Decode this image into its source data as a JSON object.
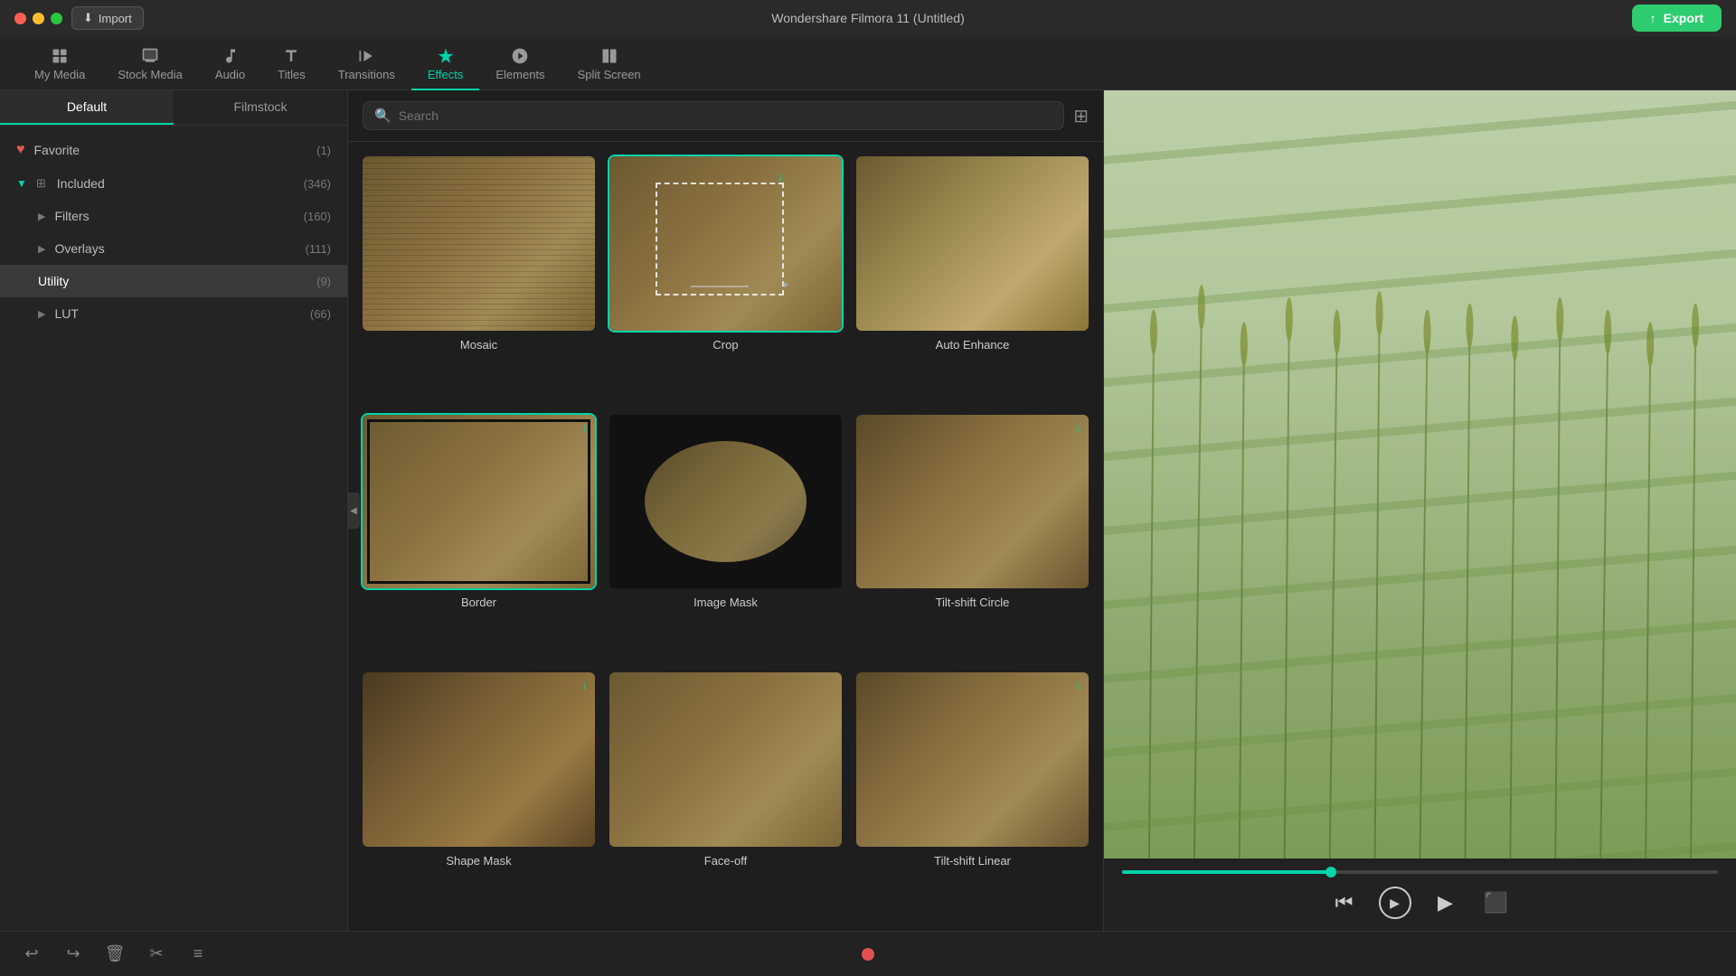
{
  "titlebar": {
    "title": "Wondershare Filmora 11 (Untitled)",
    "import_label": "Import",
    "export_label": "Export"
  },
  "nav": {
    "items": [
      {
        "id": "my-media",
        "label": "My Media",
        "icon": "grid"
      },
      {
        "id": "stock-media",
        "label": "Stock Media",
        "icon": "stock"
      },
      {
        "id": "audio",
        "label": "Audio",
        "icon": "music"
      },
      {
        "id": "titles",
        "label": "Titles",
        "icon": "text"
      },
      {
        "id": "transitions",
        "label": "Transitions",
        "icon": "transition"
      },
      {
        "id": "effects",
        "label": "Effects",
        "icon": "effects",
        "active": true
      },
      {
        "id": "elements",
        "label": "Elements",
        "icon": "elements"
      },
      {
        "id": "split-screen",
        "label": "Split Screen",
        "icon": "split"
      }
    ]
  },
  "sidebar": {
    "tabs": [
      {
        "id": "default",
        "label": "Default",
        "active": true
      },
      {
        "id": "filmstock",
        "label": "Filmstock"
      }
    ],
    "items": [
      {
        "id": "favorite",
        "label": "Favorite",
        "count": "(1)",
        "icon": "heart",
        "indent": 0
      },
      {
        "id": "included",
        "label": "Included",
        "count": "(346)",
        "icon": "grid",
        "indent": 0,
        "expanded": true
      },
      {
        "id": "filters",
        "label": "Filters",
        "count": "(160)",
        "indent": 1
      },
      {
        "id": "overlays",
        "label": "Overlays",
        "count": "(111)",
        "indent": 1
      },
      {
        "id": "utility",
        "label": "Utility",
        "count": "(9)",
        "indent": 1,
        "active": true
      },
      {
        "id": "lut",
        "label": "LUT",
        "count": "(66)",
        "indent": 1
      }
    ]
  },
  "search": {
    "placeholder": "Search"
  },
  "effects": [
    {
      "id": "mosaic",
      "label": "Mosaic",
      "type": "vineyard"
    },
    {
      "id": "crop",
      "label": "Crop",
      "type": "dashed",
      "selected": true
    },
    {
      "id": "auto-enhance",
      "label": "Auto Enhance",
      "type": "vineyard-tilt"
    },
    {
      "id": "border",
      "label": "Border",
      "type": "border",
      "selected": true
    },
    {
      "id": "image-mask",
      "label": "Image Mask",
      "type": "circle"
    },
    {
      "id": "tilt-shift-circle",
      "label": "Tilt-shift Circle",
      "type": "vineyard-blur"
    },
    {
      "id": "shape-mask",
      "label": "Shape Mask",
      "type": "vineyard-dark"
    },
    {
      "id": "face-off",
      "label": "Face-off",
      "type": "vineyard-motion"
    },
    {
      "id": "tilt-shift-linear",
      "label": "Tilt-shift Linear",
      "type": "vineyard-linear"
    }
  ],
  "bottom_toolbar": {
    "buttons": [
      "undo",
      "redo",
      "delete",
      "scissors",
      "settings"
    ]
  }
}
